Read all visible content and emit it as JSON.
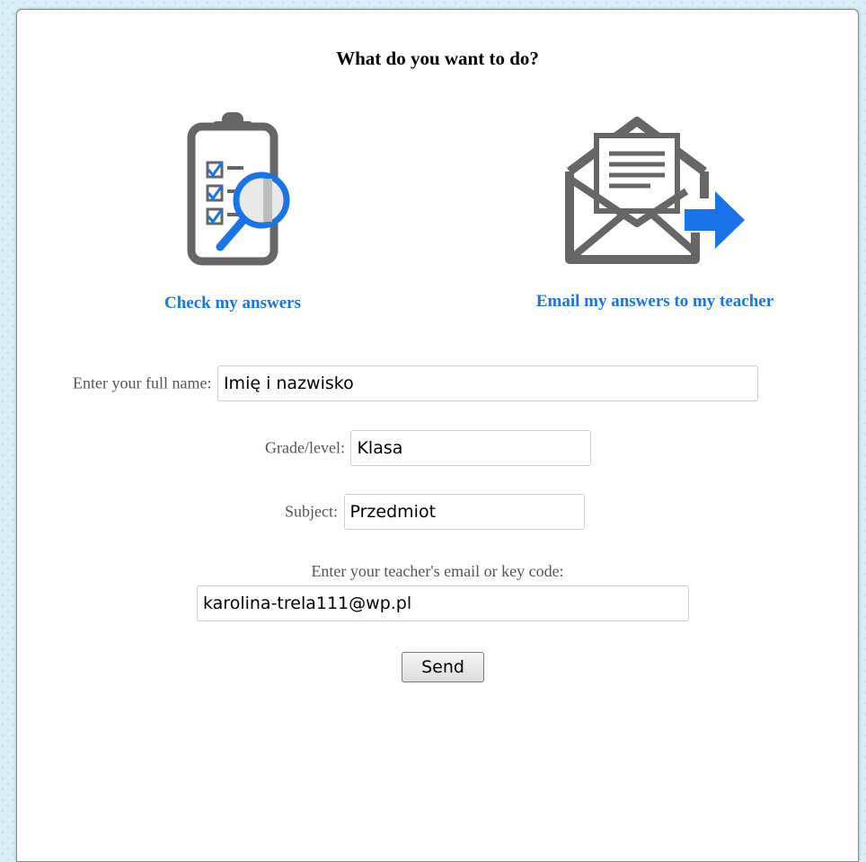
{
  "dialog": {
    "title": "What do you want to do?",
    "options": [
      {
        "label": "Check my answers",
        "icon": "clipboard-check-icon"
      },
      {
        "label": "Email my answers to my teacher",
        "icon": "envelope-send-icon"
      }
    ]
  },
  "form": {
    "name_label": "Enter your full name:",
    "name_value": "Imię i nazwisko",
    "grade_label": "Grade/level:",
    "grade_value": "Klasa",
    "subject_label": "Subject:",
    "subject_value": "Przedmiot",
    "email_label": "Enter your teacher's email or key code:",
    "email_value": "karolina-trela111@wp.pl",
    "send_label": "Send"
  },
  "colors": {
    "accent": "#1a73e8",
    "icon_gray": "#666666"
  }
}
